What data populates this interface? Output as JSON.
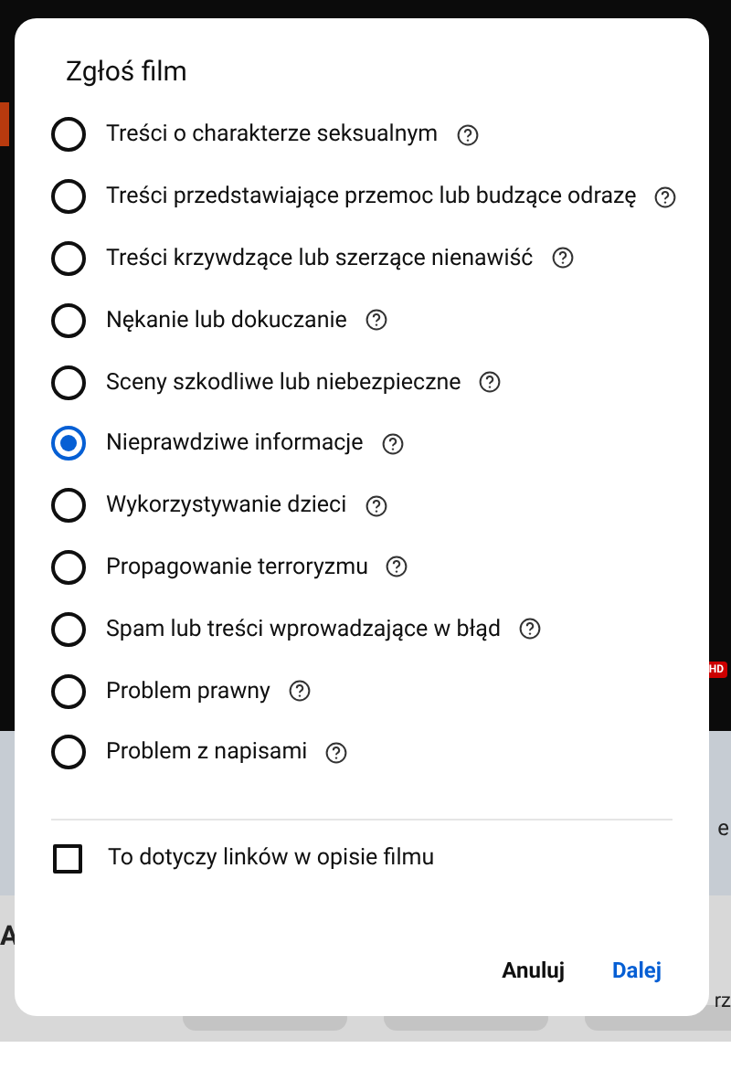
{
  "backdrop": {
    "badge": "HD",
    "fragments": [
      {
        "text": "A"
      },
      {
        "text": "e"
      },
      {
        "text": "rz"
      }
    ]
  },
  "dialog": {
    "title": "Zgłoś film",
    "options": [
      {
        "label": "Treści o charakterze seksualnym",
        "selected": false
      },
      {
        "label": "Treści przedstawiające przemoc lub budzące odrazę",
        "selected": false
      },
      {
        "label": "Treści krzywdzące lub szerzące nienawiść",
        "selected": false
      },
      {
        "label": "Nękanie lub dokuczanie",
        "selected": false
      },
      {
        "label": "Sceny szkodliwe lub niebezpieczne",
        "selected": false
      },
      {
        "label": "Nieprawdziwe informacje",
        "selected": true
      },
      {
        "label": "Wykorzystywanie dzieci",
        "selected": false
      },
      {
        "label": "Propagowanie terroryzmu",
        "selected": false
      },
      {
        "label": "Spam lub treści wprowadzające w błąd",
        "selected": false
      },
      {
        "label": "Problem prawny",
        "selected": false
      },
      {
        "label": "Problem z napisami",
        "selected": false
      }
    ],
    "checkbox": {
      "label": "To dotyczy linków w opisie filmu",
      "checked": false
    },
    "buttons": [
      {
        "label": "Anuluj",
        "kind": "secondary"
      },
      {
        "label": "Dalej",
        "kind": "primary"
      }
    ]
  }
}
